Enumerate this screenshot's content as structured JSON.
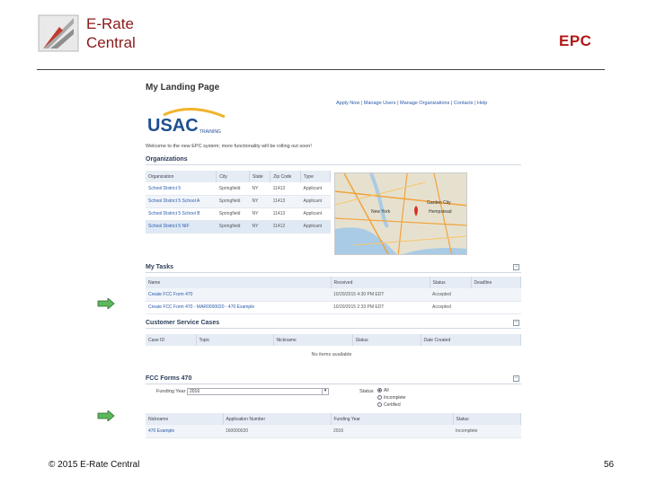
{
  "slide": {
    "brand_line1": "E-Rate",
    "brand_line2": "Central",
    "title": "EPC",
    "footer": "© 2015 E-Rate Central",
    "page_number": "56"
  },
  "epc": {
    "page_title": "My Landing Page",
    "top_links": "Apply Now | Manage Users | Manage Organizations | Contacts | Help",
    "logo_text": "USAC",
    "logo_sub": "TRAINING",
    "welcome": "Welcome to the new EPC system; more functionality will be rolling out soon!",
    "organizations": {
      "heading": "Organizations",
      "columns": [
        "Organization",
        "City",
        "State",
        "Zip Code",
        "Type"
      ],
      "rows": [
        [
          "School District 5",
          "Springfield",
          "NY",
          "11413",
          "Applicant"
        ],
        [
          "School District 5 School A",
          "Springfield",
          "NY",
          "11413",
          "Applicant"
        ],
        [
          "School District 5 School B",
          "Springfield",
          "NY",
          "11413",
          "Applicant"
        ],
        [
          "School District 5 NIF",
          "Springfield",
          "NY",
          "11412",
          "Applicant"
        ]
      ]
    },
    "map": {
      "label_new_york": "New York",
      "label_city": "Garden City",
      "label_hempstead": "Hempstead"
    },
    "tasks": {
      "heading": "My Tasks",
      "columns": [
        "Name",
        "Received",
        "Status",
        "Deadline"
      ],
      "rows": [
        [
          "Create FCC Form 470",
          "10/20/2015 4:30 PM EDT",
          "Accepted",
          ""
        ],
        [
          "Create FCC Form 470 - MAR0000020 - 470 Example",
          "10/20/2015 2:33 PM EDT",
          "Accepted",
          ""
        ]
      ]
    },
    "cases": {
      "heading": "Customer Service Cases",
      "columns": [
        "Case ID",
        "Topic",
        "Nickname",
        "Status",
        "Date Created"
      ],
      "empty_text": "No items available"
    },
    "forms470": {
      "heading": "FCC Forms 470",
      "funding_year_label": "Funding Year",
      "funding_year_value": "2016",
      "status_label": "Status",
      "status_options": [
        "All",
        "Incomplete",
        "Certified"
      ],
      "columns": [
        "Nickname",
        "Application Number",
        "Funding Year",
        "Status"
      ],
      "rows": [
        [
          "470 Example",
          "160000020",
          "2016",
          "Incomplete"
        ]
      ]
    }
  },
  "colors": {
    "brand": "#8b1a1a",
    "title_red": "#b01818",
    "arrow_green": "#5cb85c",
    "link_blue": "#2a5aa8"
  }
}
